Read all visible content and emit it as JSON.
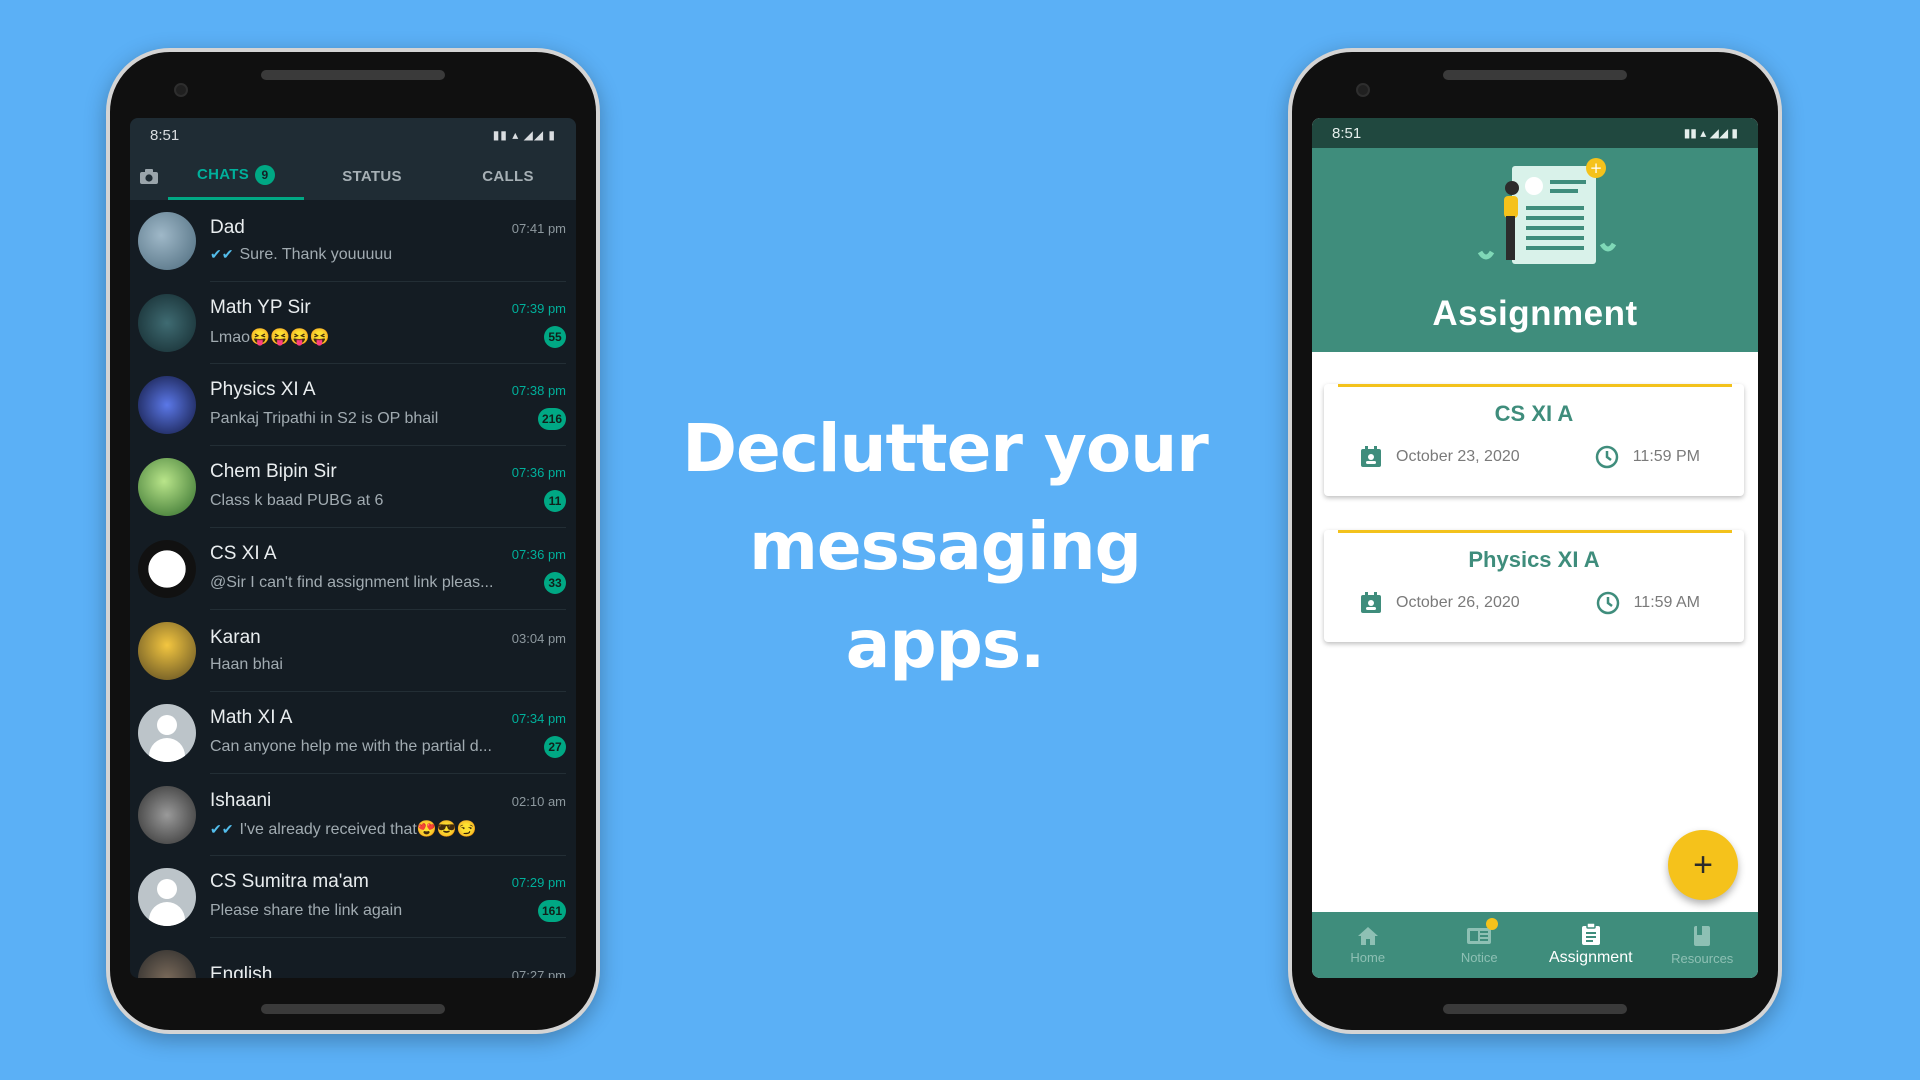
{
  "headline": {
    "line1": "Declutter your",
    "line2": "messaging",
    "line3": "apps."
  },
  "chat_app": {
    "status_time": "8:51",
    "status_right": "▮▮ ▴ ◢◢ ▮",
    "tabs": [
      {
        "label": "CHATS",
        "count": "9"
      },
      {
        "label": "STATUS"
      },
      {
        "label": "CALLS"
      }
    ],
    "chats": [
      {
        "name": "Dad",
        "time": "07:41 pm",
        "message": "Sure. Thank youuuuu",
        "read": true,
        "badge": ""
      },
      {
        "name": "Math YP Sir",
        "time": "07:39 pm",
        "message": "Lmao😝😝😝😝",
        "read": false,
        "badge": "55"
      },
      {
        "name": "Physics XI A",
        "time": "07:38 pm",
        "message": "Pankaj Tripathi in S2 is OP bhail",
        "read": false,
        "badge": "216"
      },
      {
        "name": "Chem Bipin Sir",
        "time": "07:36 pm",
        "message": "Class k baad PUBG at 6",
        "read": false,
        "badge": "11"
      },
      {
        "name": "CS XI A",
        "time": "07:36 pm",
        "message": "@Sir I can't find assignment link pleas...",
        "read": false,
        "badge": "33"
      },
      {
        "name": "Karan",
        "time": "03:04 pm",
        "message": "Haan bhai",
        "read": false,
        "badge": ""
      },
      {
        "name": "Math XI A",
        "time": "07:34 pm",
        "message": "Can anyone help me with the partial d...",
        "read": false,
        "badge": "27"
      },
      {
        "name": "Ishaani",
        "time": "02:10 am",
        "message": "I've already received that😍😎😏",
        "read": true,
        "badge": ""
      },
      {
        "name": "CS Sumitra ma'am",
        "time": "07:29 pm",
        "message": "Please share the link again",
        "read": false,
        "badge": "161"
      },
      {
        "name": "English",
        "time": "07:27 pm",
        "message": "",
        "read": false,
        "badge": ""
      }
    ]
  },
  "assignment_app": {
    "status_time": "8:51",
    "status_right": "▮▮ ▴ ◢◢ ▮",
    "title": "Assignment",
    "cards": [
      {
        "subject": "CS XI A",
        "date": "October 23, 2020",
        "time": "11:59 PM"
      },
      {
        "subject": "Physics XI A",
        "date": "October 26, 2020",
        "time": "11:59 AM"
      }
    ],
    "fab_label": "+",
    "nav": [
      {
        "label": "Home",
        "icon": "home-icon"
      },
      {
        "label": "Notice",
        "icon": "notice-icon"
      },
      {
        "label": "Assignment",
        "icon": "clipboard-icon"
      },
      {
        "label": "Resources",
        "icon": "book-icon"
      }
    ]
  },
  "colors": {
    "background": "#5bb0f6",
    "chat_bg": "#141c23",
    "chat_accent": "#00a884",
    "assign_primary": "#3f8d7c",
    "assign_accent": "#f5c21b"
  }
}
